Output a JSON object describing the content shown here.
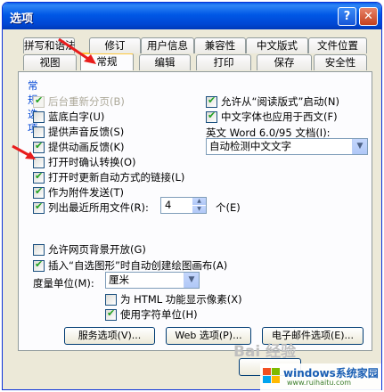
{
  "window": {
    "title": "选项",
    "help_glyph": "?",
    "close_glyph": "✕"
  },
  "tabs_row1": [
    "拼写和语法",
    "修订",
    "用户信息",
    "兼容性",
    "中文版式",
    "文件位置"
  ],
  "tabs_row2": [
    "视图",
    "常规",
    "编辑",
    "打印",
    "保存",
    "安全性"
  ],
  "active_tab": "常规",
  "section_title": "常规选项",
  "left_options": [
    {
      "label": "后台重新分页(B)",
      "checked": true,
      "disabled": true
    },
    {
      "label": "蓝底白字(U)",
      "checked": false
    },
    {
      "label": "提供声音反馈(S)",
      "checked": false
    },
    {
      "label": "提供动画反馈(K)",
      "checked": true
    },
    {
      "label": "打开时确认转换(O)",
      "checked": false
    },
    {
      "label": "打开时更新自动方式的链接(L)",
      "checked": true
    },
    {
      "label": "作为附件发送(T)",
      "checked": true
    },
    {
      "label": "列出最近所用文件(R):",
      "checked": true
    }
  ],
  "recent_files": {
    "value": "4",
    "unit": "个(E)"
  },
  "right_options": [
    {
      "label": "允许从“阅读版式”启动(N)",
      "checked": true
    },
    {
      "label": "中文字体也应用于西文(F)",
      "checked": true
    }
  ],
  "doc_label": "英文 Word 6.0/95 文档(I):",
  "doc_select": "自动检测中文文字",
  "lower_options": [
    {
      "label": "允许网页背景开放(G)",
      "checked": false
    },
    {
      "label": "插入“自选图形”时自动创建绘图画布(A)",
      "checked": true
    }
  ],
  "measure": {
    "label": "度量单位(M):",
    "value": "厘米"
  },
  "html_pixels": {
    "label": "为 HTML 功能显示像素(X)",
    "checked": false
  },
  "char_units": {
    "label": "使用字符单位(H)",
    "checked": true
  },
  "buttons": [
    "服务选项(V)...",
    "Web 选项(P)...",
    "电子邮件选项(E)..."
  ],
  "watermark": {
    "baidu": "Bai 经验",
    "site": "windows系统家园",
    "url": "www.ruihaitu.com"
  },
  "colors": {
    "accent_blue": "#0046d5",
    "annotation_red": "#e81c1c",
    "tab_highlight": "#ffc83c"
  }
}
